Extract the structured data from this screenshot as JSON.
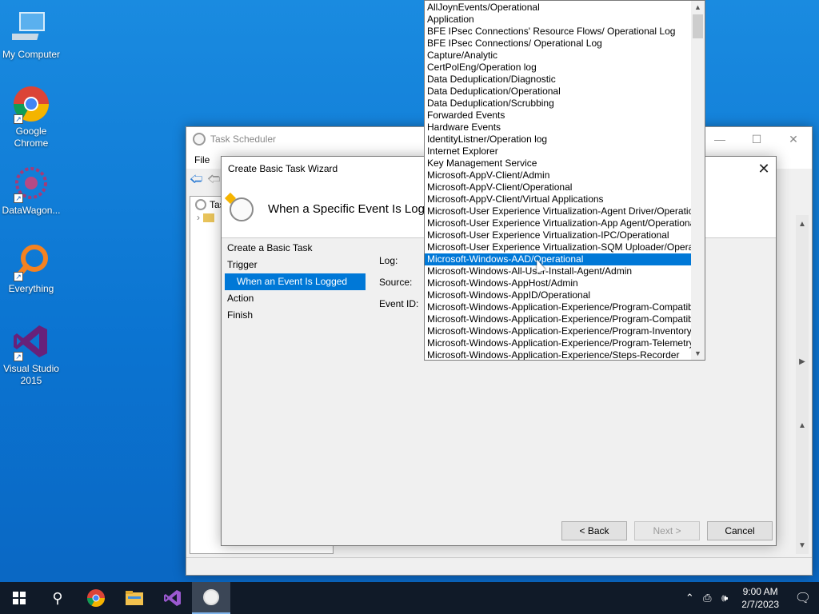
{
  "desktop": {
    "icons": [
      {
        "label": "My Computer"
      },
      {
        "label": "Google Chrome"
      },
      {
        "label": "DataWagon..."
      },
      {
        "label": "Everything"
      },
      {
        "label": "Visual Studio 2015"
      }
    ]
  },
  "task_scheduler": {
    "title": "Task Scheduler",
    "menu": {
      "file": "File"
    },
    "tree_item": "Tas"
  },
  "wizard": {
    "title": "Create Basic Task Wizard",
    "header_title": "When a Specific Event Is Logged",
    "nav": [
      {
        "label": "Create a Basic Task",
        "selected": false
      },
      {
        "label": "Trigger",
        "selected": false
      },
      {
        "label": "When an Event Is Logged",
        "selected": true
      },
      {
        "label": "Action",
        "selected": false
      },
      {
        "label": "Finish",
        "selected": false
      }
    ],
    "form": {
      "log_label": "Log:",
      "source_label": "Source:",
      "event_id_label": "Event ID:"
    },
    "buttons": {
      "back": "< Back",
      "next": "Next >",
      "cancel": "Cancel"
    }
  },
  "log_dropdown": {
    "selected_index": 21,
    "items": [
      "AllJoynEvents/Operational",
      "Application",
      "BFE IPsec Connections' Resource Flows/ Operational Log",
      "BFE IPsec Connections/ Operational Log",
      "Capture/Analytic",
      "CertPolEng/Operation log",
      "Data Deduplication/Diagnostic",
      "Data Deduplication/Operational",
      "Data Deduplication/Scrubbing",
      "Forwarded Events",
      "Hardware Events",
      "IdentityListner/Operation log",
      "Internet Explorer",
      "Key Management Service",
      "Microsoft-AppV-Client/Admin",
      "Microsoft-AppV-Client/Operational",
      "Microsoft-AppV-Client/Virtual Applications",
      "Microsoft-User Experience Virtualization-Agent Driver/Operational",
      "Microsoft-User Experience Virtualization-App Agent/Operational",
      "Microsoft-User Experience Virtualization-IPC/Operational",
      "Microsoft-User Experience Virtualization-SQM Uploader/Operational",
      "Microsoft-Windows-AAD/Operational",
      "Microsoft-Windows-All-User-Install-Agent/Admin",
      "Microsoft-Windows-AppHost/Admin",
      "Microsoft-Windows-AppID/Operational",
      "Microsoft-Windows-Application-Experience/Program-Compatibility-Assistant",
      "Microsoft-Windows-Application-Experience/Program-Compatibility-Troubleshooter",
      "Microsoft-Windows-Application-Experience/Program-Inventory",
      "Microsoft-Windows-Application-Experience/Program-Telemetry",
      "Microsoft-Windows-Application-Experience/Steps-Recorder"
    ]
  },
  "taskbar": {
    "time": "9:00 AM",
    "date": "2/7/2023"
  }
}
